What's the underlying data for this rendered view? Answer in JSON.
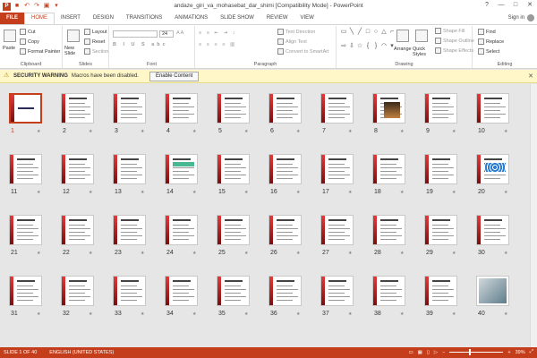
{
  "window": {
    "title": "andaze_giri_va_mohasebat_dar_shimi [Compatibility Mode] - PowerPoint",
    "sign_in": "Sign in",
    "controls": [
      "?",
      "—",
      "□",
      "✕"
    ]
  },
  "tabs": [
    "FILE",
    "HOME",
    "INSERT",
    "DESIGN",
    "TRANSITIONS",
    "ANIMATIONS",
    "SLIDE SHOW",
    "REVIEW",
    "VIEW"
  ],
  "ribbon": {
    "clipboard": {
      "label": "Clipboard",
      "paste": "Paste",
      "cut": "Cut",
      "copy": "Copy",
      "format_painter": "Format Painter"
    },
    "slides": {
      "label": "Slides",
      "new_slide": "New Slide",
      "layout": "Layout",
      "reset": "Reset",
      "section": "Section"
    },
    "font": {
      "label": "Font",
      "size": "24"
    },
    "paragraph": {
      "label": "Paragraph",
      "text_direction": "Text Direction",
      "align_text": "Align Text",
      "convert": "Convert to SmartArt"
    },
    "drawing": {
      "label": "Drawing",
      "arrange": "Arrange",
      "quick_styles": "Quick Styles",
      "shape_fill": "Shape Fill",
      "shape_outline": "Shape Outline",
      "shape_effects": "Shape Effects"
    },
    "editing": {
      "label": "Editing",
      "find": "Find",
      "replace": "Replace",
      "select": "Select"
    }
  },
  "security": {
    "title": "SECURITY WARNING",
    "message": "Macros have been disabled.",
    "button": "Enable Content"
  },
  "slides": [
    {
      "n": "1"
    },
    {
      "n": "2"
    },
    {
      "n": "3"
    },
    {
      "n": "4"
    },
    {
      "n": "5"
    },
    {
      "n": "6"
    },
    {
      "n": "7"
    },
    {
      "n": "8"
    },
    {
      "n": "9"
    },
    {
      "n": "10"
    },
    {
      "n": "11"
    },
    {
      "n": "12"
    },
    {
      "n": "13"
    },
    {
      "n": "14"
    },
    {
      "n": "15"
    },
    {
      "n": "16"
    },
    {
      "n": "17"
    },
    {
      "n": "18"
    },
    {
      "n": "19"
    },
    {
      "n": "20"
    },
    {
      "n": "21"
    },
    {
      "n": "22"
    },
    {
      "n": "23"
    },
    {
      "n": "24"
    },
    {
      "n": "25"
    },
    {
      "n": "26"
    },
    {
      "n": "27"
    },
    {
      "n": "28"
    },
    {
      "n": "29"
    },
    {
      "n": "30"
    },
    {
      "n": "31"
    },
    {
      "n": "32"
    },
    {
      "n": "33"
    },
    {
      "n": "34"
    },
    {
      "n": "35"
    },
    {
      "n": "36"
    },
    {
      "n": "37"
    },
    {
      "n": "38"
    },
    {
      "n": "39"
    },
    {
      "n": "40"
    }
  ],
  "selected_slide": "1",
  "status": {
    "slide_info": "SLIDE 1 OF 40",
    "language": "ENGLISH (UNITED STATES)",
    "zoom": "39%"
  },
  "colors": {
    "accent": "#c43e1c",
    "warning_bg": "#fff7c8"
  }
}
